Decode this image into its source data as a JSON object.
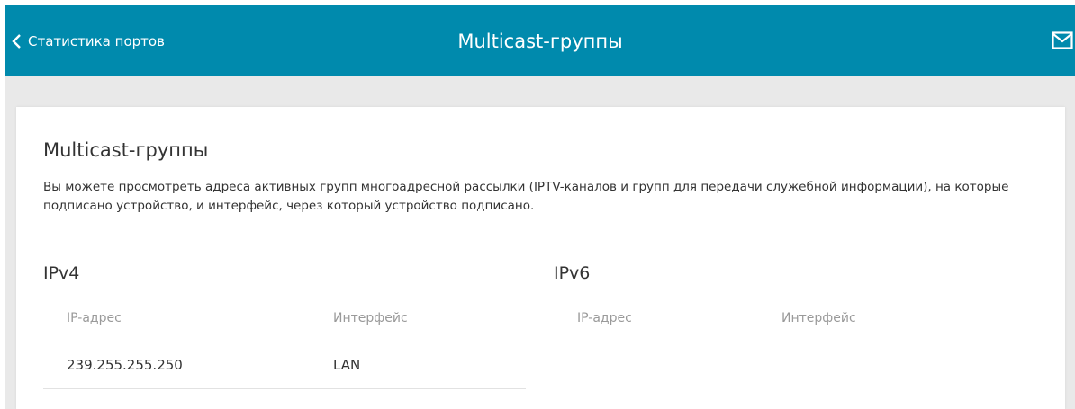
{
  "header": {
    "back_label": "Статистика портов",
    "title": "Multicast-группы",
    "mail_icon": "mail-icon",
    "back_icon": "chevron-left-icon"
  },
  "card": {
    "title": "Multicast-группы",
    "description": "Вы можете просмотреть адреса активных групп многоадресной рассылки (IPTV-каналов и групп для передачи служебной информации), на которые подписано устройство, и интерфейс, через который устройство подписано."
  },
  "ipv4": {
    "title": "IPv4",
    "columns": [
      "IP-адрес",
      "Интерфейс"
    ],
    "rows": [
      {
        "ip": "239.255.255.250",
        "interface": "LAN"
      }
    ]
  },
  "ipv6": {
    "title": "IPv6",
    "columns": [
      "IP-адрес",
      "Интерфейс"
    ],
    "rows": []
  },
  "colors": {
    "header_bg": "#008aad",
    "page_bg": "#e9e9e9",
    "card_bg": "#ffffff",
    "text": "#333333",
    "muted": "#9a9a9a"
  }
}
